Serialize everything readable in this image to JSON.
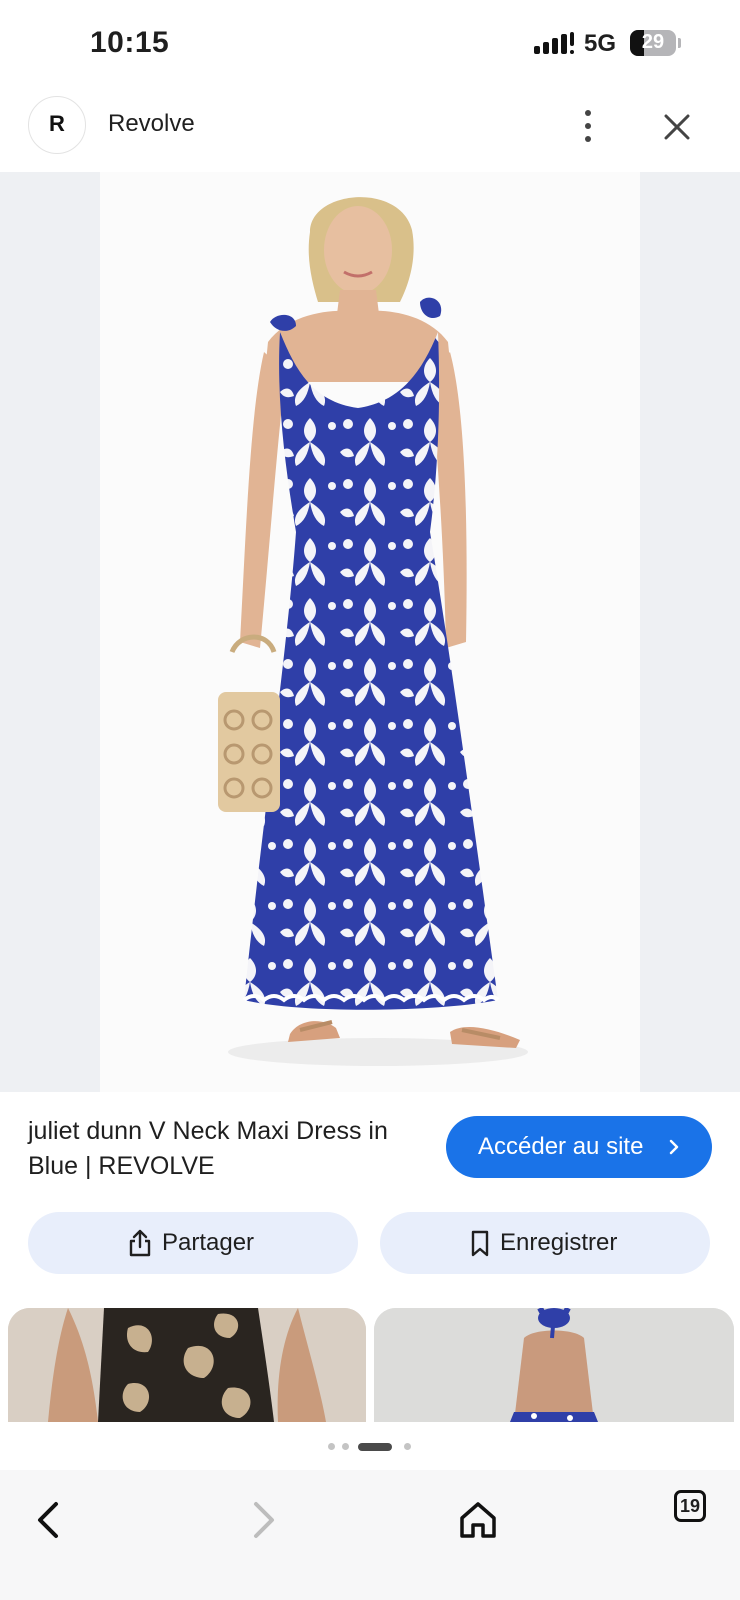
{
  "status_bar": {
    "time": "10:15",
    "network": "5G",
    "battery": "29"
  },
  "header": {
    "favicon_letter": "R",
    "site_name": "Revolve",
    "menu_icon": "more-vert-icon",
    "close_icon": "close-icon"
  },
  "product": {
    "image_alt": "Model wearing blue and white floral print maxi dress holding a straw bag",
    "title": "juliet dunn V Neck Maxi Dress in Blue | REVOLVE",
    "visit_label": "Accéder au site",
    "share_label": "Partager",
    "save_label": "Enregistrer"
  },
  "related": [
    {
      "thumb": "related-result-1"
    },
    {
      "thumb": "related-result-2"
    }
  ],
  "pager": {
    "count": 4,
    "active": 2
  },
  "navbar": {
    "tabs_count": "19"
  },
  "colors": {
    "accent": "#1a73e8",
    "chip_bg": "#e8eefb",
    "dress_blue": "#2f3fa8"
  }
}
